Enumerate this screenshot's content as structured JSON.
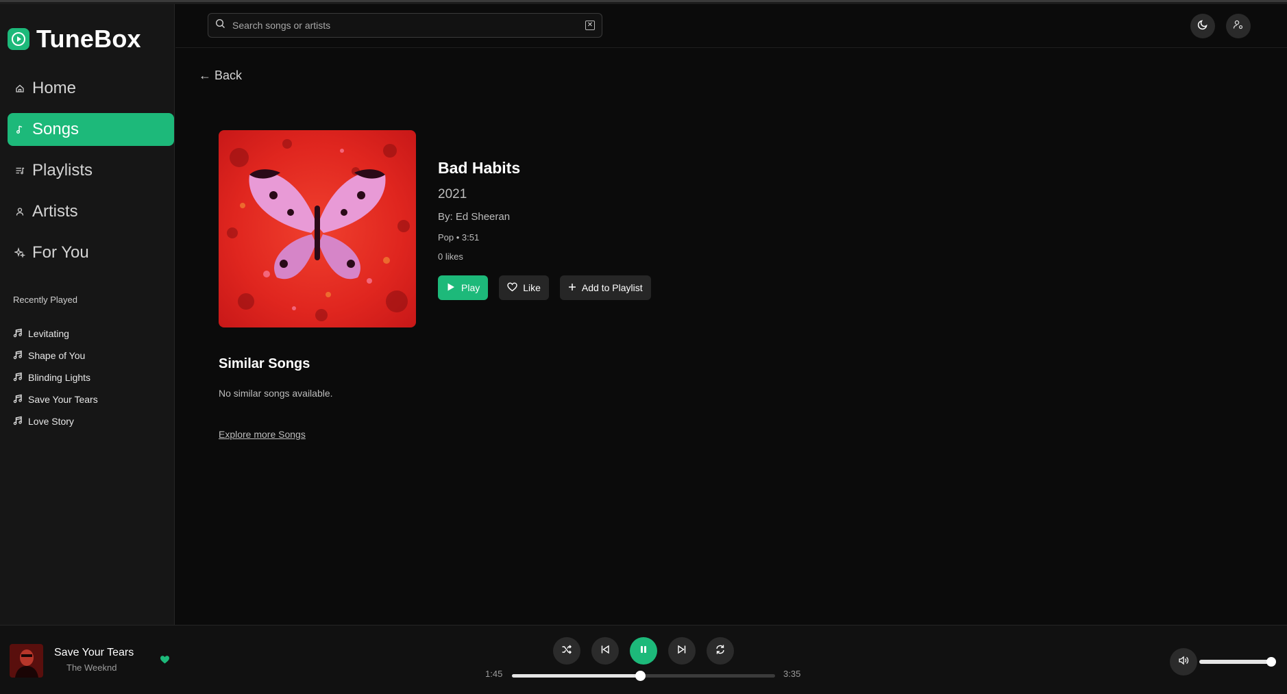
{
  "app": {
    "name": "TuneBox"
  },
  "sidebar": {
    "nav": [
      {
        "label": "Home",
        "icon": "home-icon",
        "active": false
      },
      {
        "label": "Songs",
        "icon": "music-note-icon",
        "active": true
      },
      {
        "label": "Playlists",
        "icon": "playlist-icon",
        "active": false
      },
      {
        "label": "Artists",
        "icon": "user-icon",
        "active": false
      },
      {
        "label": "For You",
        "icon": "sparkles-icon",
        "active": false
      }
    ],
    "recent_title": "Recently Played",
    "recent": [
      "Levitating",
      "Shape of You",
      "Blinding Lights",
      "Save Your Tears",
      "Love Story"
    ]
  },
  "header": {
    "search_placeholder": "Search songs or artists"
  },
  "main": {
    "back_label": "← Back",
    "song": {
      "title": "Bad Habits",
      "year": "2021",
      "artist_line": "By: Ed Sheeran",
      "meta": "Pop • 3:51",
      "likes": "0 likes"
    },
    "actions": {
      "play": "Play",
      "like": "Like",
      "add": "Add to Playlist"
    },
    "similar_title": "Similar Songs",
    "similar_empty": "No similar songs available.",
    "explore_link": "Explore more Songs"
  },
  "player": {
    "track": "Save Your Tears",
    "artist": "The Weeknd",
    "liked": true,
    "elapsed": "1:45",
    "duration": "3:35",
    "progress_fraction": 0.488,
    "volume_fraction": 0.95
  },
  "colors": {
    "accent": "#1db97a",
    "background": "#0b0b0b",
    "sidebar": "#161616"
  }
}
